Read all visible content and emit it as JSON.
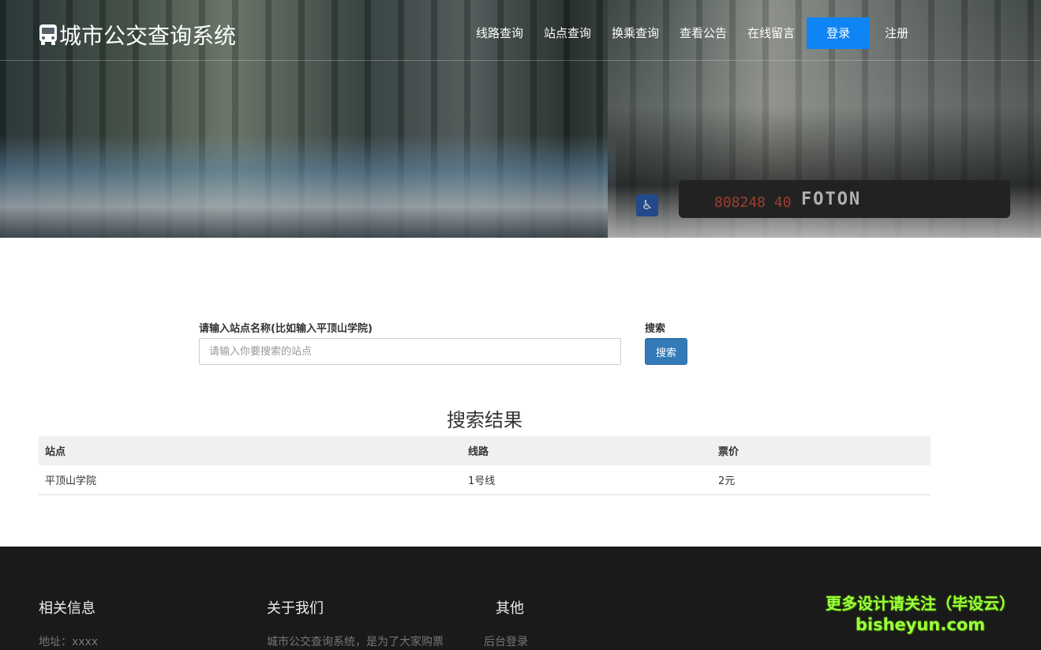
{
  "site": {
    "title": "城市公交查询系统"
  },
  "nav": {
    "items": [
      {
        "label": "线路查询"
      },
      {
        "label": "站点查询"
      },
      {
        "label": "换乘查询"
      },
      {
        "label": "查看公告"
      },
      {
        "label": "在线留言"
      }
    ],
    "login": "登录",
    "register": "注册"
  },
  "hero": {
    "bus_brand": "FOTON",
    "plate_text": "808248 40"
  },
  "search": {
    "label": "请输入站点名称(比如输入平顶山学院)",
    "placeholder": "请输入你要搜索的站点",
    "button_label_heading": "搜索",
    "button": "搜索"
  },
  "results": {
    "title": "搜索结果",
    "columns": [
      "站点",
      "线路",
      "票价"
    ],
    "rows": [
      {
        "station": "平顶山学院",
        "line": "1号线",
        "price": "2元"
      }
    ]
  },
  "footer": {
    "col1": {
      "title": "相关信息",
      "text": "地址：xxxx"
    },
    "col2": {
      "title": "关于我们",
      "text": "城市公交查询系统，是为了大家购票"
    },
    "col3": {
      "title": "其他",
      "text": "后台登录"
    },
    "watermark": {
      "line1": "更多设计请关注（毕设云）",
      "line2": "bisheyun.com"
    }
  },
  "colors": {
    "login_button": "#0f84f5",
    "search_button": "#337ab7",
    "footer_bg": "#1a1a1a"
  }
}
